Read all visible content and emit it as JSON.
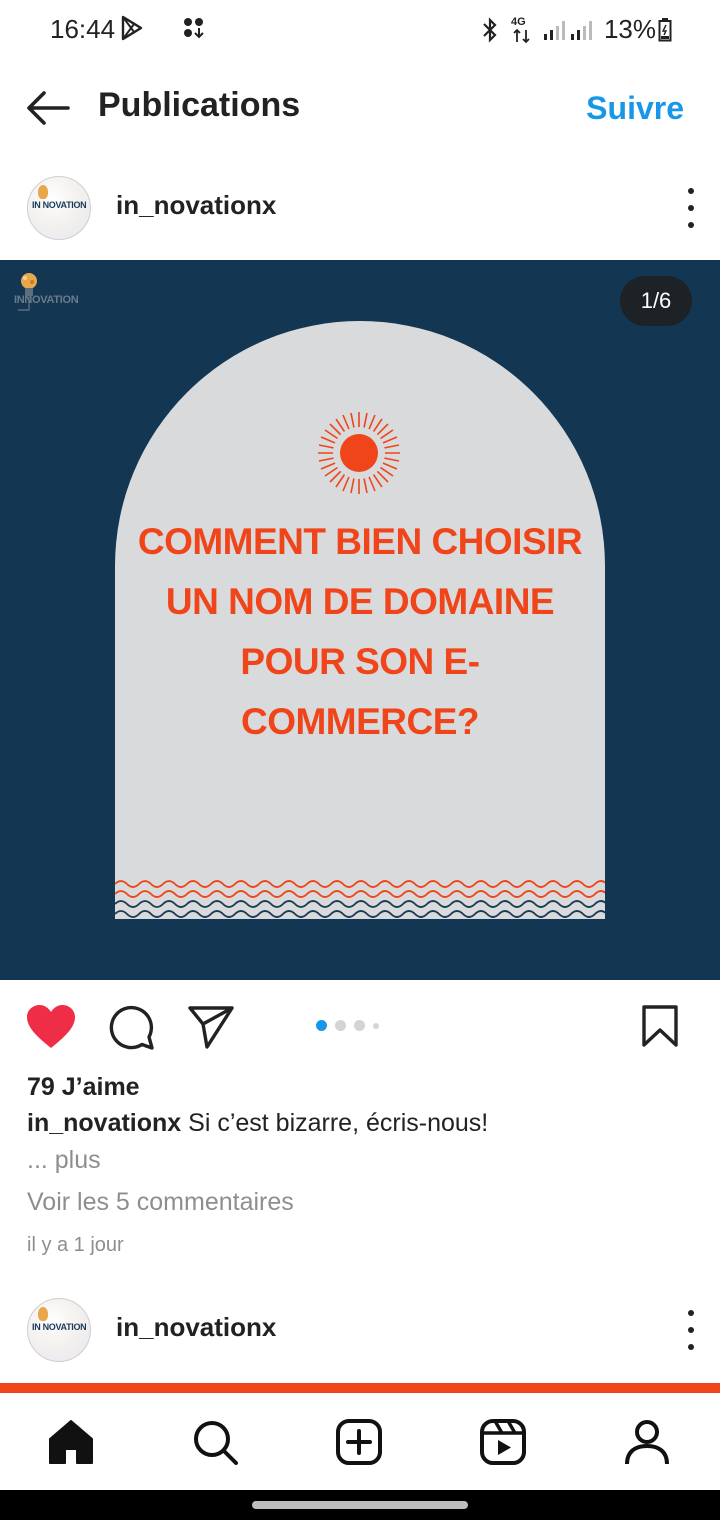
{
  "status_bar": {
    "time": "16:44",
    "network": "4G",
    "battery": "13%",
    "icons": [
      "play-store-icon",
      "notification-dots-icon",
      "bluetooth-icon",
      "network-4g-icon",
      "signal-icon",
      "battery-icon"
    ]
  },
  "header": {
    "title": "Publications",
    "follow_label": "Suivre",
    "back_icon": "arrow-left-icon"
  },
  "post": {
    "username": "in_novationx",
    "avatar_logo": "IN NOVATION",
    "brand_watermark": "INNOVATION",
    "counter": "1/6",
    "headline": "COMMENT BIEN CHOISIR UN NOM DE DOMAINE POUR SON E-COMMERCE?",
    "carousel": {
      "total_dots": 4,
      "active_index": 0
    },
    "likes": "79 J’aime",
    "caption_user": "in_novationx",
    "caption_text": "Si c’est bizarre, écris-nous!",
    "more_label": "... plus",
    "comments_label": "Voir les 5 commentaires",
    "time_ago": "il y a 1 jour",
    "liked": true
  },
  "next_post": {
    "username": "in_novationx",
    "avatar_logo": "IN NOVATION"
  },
  "tabbar": {
    "items": [
      "home-icon",
      "search-icon",
      "create-icon",
      "reels-icon",
      "profile-icon"
    ]
  },
  "colors": {
    "accent_blue": "#1897e8",
    "like_red": "#ef2d46",
    "post_bg": "#133653",
    "headline_orange": "#f0451a",
    "arch_grey": "#d8dadc"
  }
}
